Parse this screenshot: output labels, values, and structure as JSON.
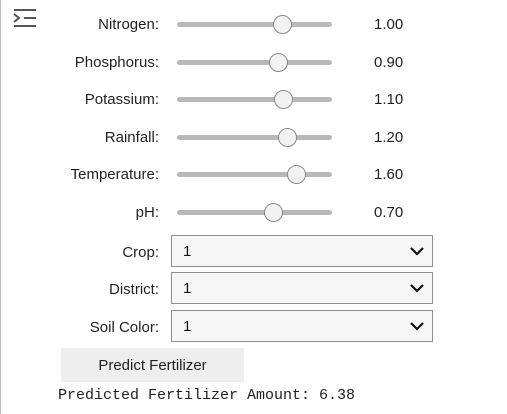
{
  "sliders": [
    {
      "label": "Nitrogen:",
      "value": "1.00",
      "fraction": 0.68
    },
    {
      "label": "Phosphorus:",
      "value": "0.90",
      "fraction": 0.655
    },
    {
      "label": "Potassium:",
      "value": "1.10",
      "fraction": 0.69
    },
    {
      "label": "Rainfall:",
      "value": "1.20",
      "fraction": 0.71
    },
    {
      "label": "Temperature:",
      "value": "1.60",
      "fraction": 0.77
    },
    {
      "label": "pH:",
      "value": "0.70",
      "fraction": 0.62
    }
  ],
  "dropdowns": [
    {
      "label": "Crop:",
      "value": "1"
    },
    {
      "label": "District:",
      "value": "1"
    },
    {
      "label": "Soil Color:",
      "value": "1"
    }
  ],
  "predict_button": {
    "label": "Predict Fertilizer"
  },
  "result": {
    "text": "Predicted Fertilizer Amount: 6.38"
  },
  "icons": {
    "collapse": "collapse-output-icon",
    "dropdown": "chevron-down-icon"
  }
}
